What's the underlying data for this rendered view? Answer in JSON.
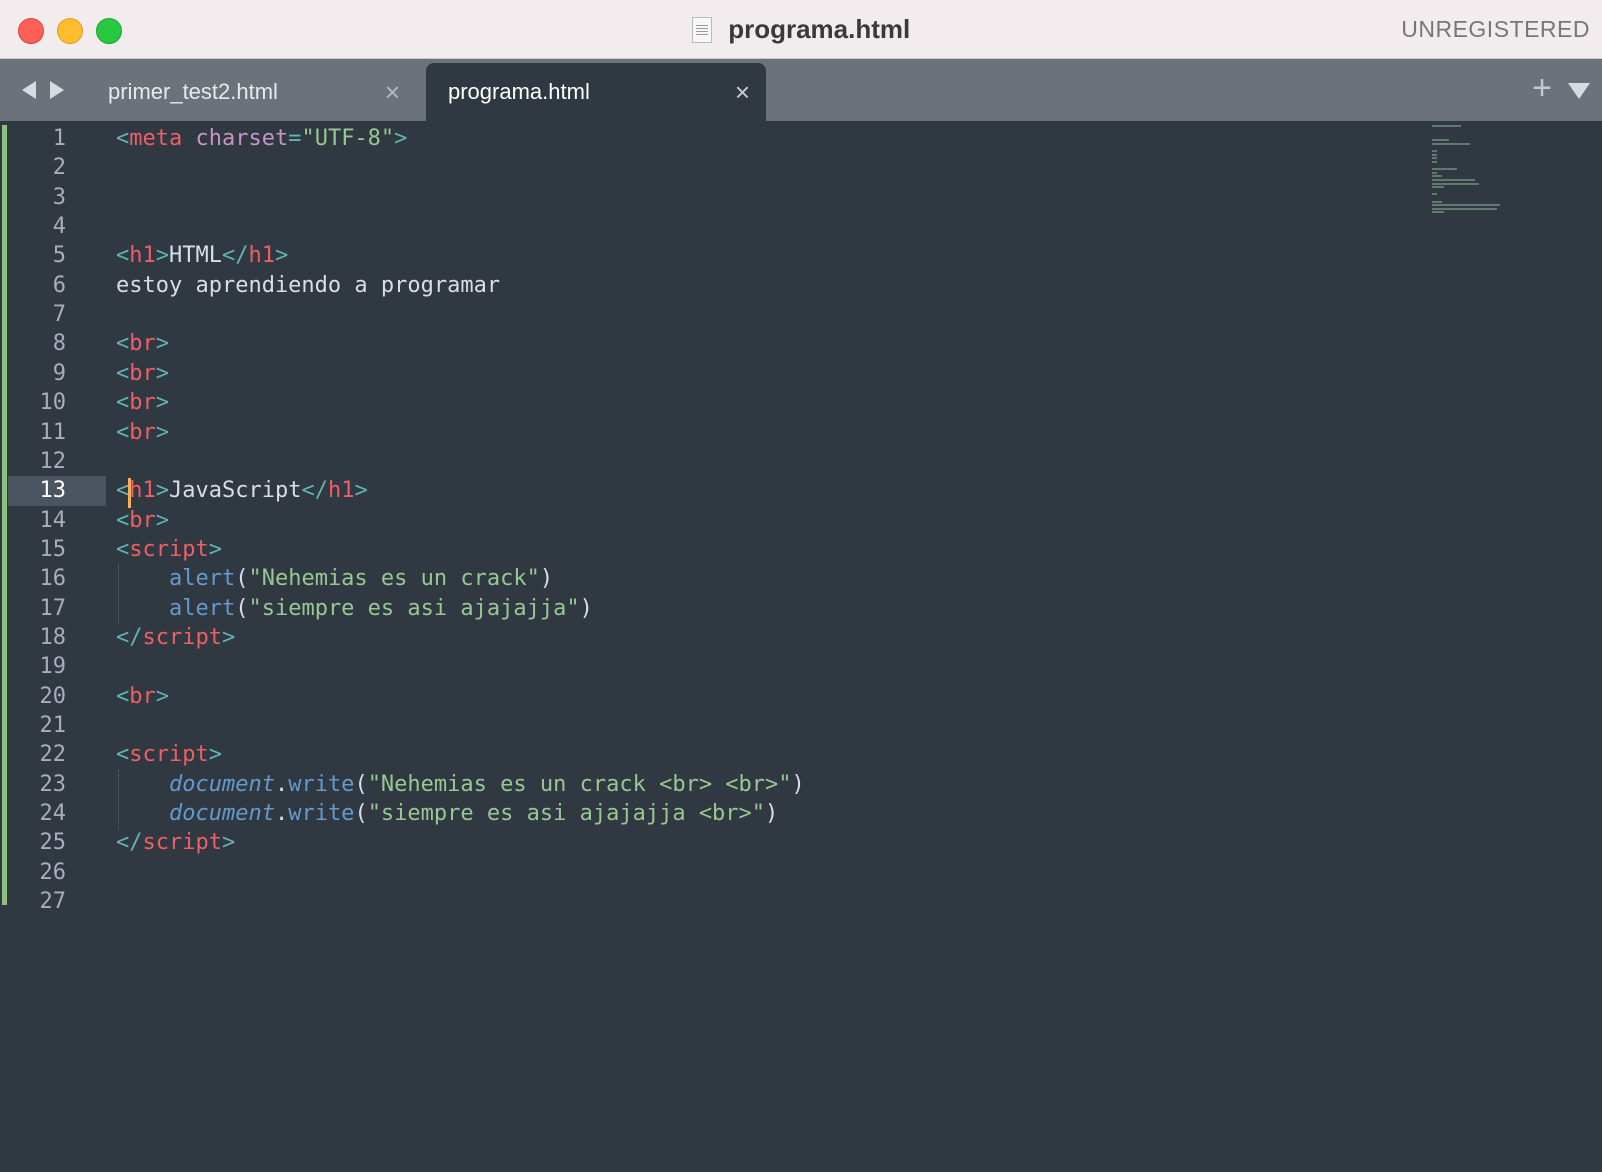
{
  "window": {
    "title": "programa.html",
    "status": "UNREGISTERED",
    "controls": [
      "close",
      "minimize",
      "maximize"
    ]
  },
  "tabs": [
    {
      "label": "primer_test2.html",
      "active": false,
      "close": "×"
    },
    {
      "label": "programa.html",
      "active": true,
      "close": "×"
    }
  ],
  "tabbar": {
    "add_label": "+",
    "back_icon": "chevron-left-icon",
    "forward_icon": "chevron-right-icon",
    "menu_icon": "triangle-down-icon"
  },
  "editor": {
    "current_line": 13,
    "line_numbers": [
      "1",
      "2",
      "3",
      "4",
      "5",
      "6",
      "7",
      "8",
      "9",
      "10",
      "11",
      "12",
      "13",
      "14",
      "15",
      "16",
      "17",
      "18",
      "19",
      "20",
      "21",
      "22",
      "23",
      "24",
      "25",
      "26",
      "27"
    ],
    "lines": [
      [
        [
          "p",
          "<"
        ],
        [
          "t",
          "meta"
        ],
        [
          "n",
          " "
        ],
        [
          "a",
          "charset"
        ],
        [
          "p",
          "="
        ],
        [
          "s",
          "\"UTF-8\""
        ],
        [
          "p",
          ">"
        ]
      ],
      [],
      [],
      [],
      [
        [
          "p",
          "<"
        ],
        [
          "t",
          "h1"
        ],
        [
          "p",
          ">"
        ],
        [
          "n",
          "HTML"
        ],
        [
          "p",
          "</"
        ],
        [
          "t",
          "h1"
        ],
        [
          "p",
          ">"
        ]
      ],
      [
        [
          "n",
          "estoy aprendiendo a programar"
        ]
      ],
      [],
      [
        [
          "p",
          "<"
        ],
        [
          "t",
          "br"
        ],
        [
          "p",
          ">"
        ]
      ],
      [
        [
          "p",
          "<"
        ],
        [
          "t",
          "br"
        ],
        [
          "p",
          ">"
        ]
      ],
      [
        [
          "p",
          "<"
        ],
        [
          "t",
          "br"
        ],
        [
          "p",
          ">"
        ]
      ],
      [
        [
          "p",
          "<"
        ],
        [
          "t",
          "br"
        ],
        [
          "p",
          ">"
        ]
      ],
      [],
      [
        [
          "p",
          "<"
        ],
        [
          "t",
          "h1"
        ],
        [
          "p",
          ">"
        ],
        [
          "n",
          "JavaScript"
        ],
        [
          "p",
          "</"
        ],
        [
          "t",
          "h1"
        ],
        [
          "p",
          ">"
        ]
      ],
      [
        [
          "p",
          "<"
        ],
        [
          "t",
          "br"
        ],
        [
          "p",
          ">"
        ]
      ],
      [
        [
          "p",
          "<"
        ],
        [
          "t",
          "script"
        ],
        [
          "p",
          ">"
        ]
      ],
      [
        [
          "n",
          "    "
        ],
        [
          "f",
          "alert"
        ],
        [
          "n",
          "("
        ],
        [
          "s",
          "\"Nehemias es un crack\""
        ],
        [
          "n",
          ")"
        ]
      ],
      [
        [
          "n",
          "    "
        ],
        [
          "f",
          "alert"
        ],
        [
          "n",
          "("
        ],
        [
          "s",
          "\"siempre es asi ajajajja\""
        ],
        [
          "n",
          ")"
        ]
      ],
      [
        [
          "p",
          "</"
        ],
        [
          "t",
          "script"
        ],
        [
          "p",
          ">"
        ]
      ],
      [],
      [
        [
          "p",
          "<"
        ],
        [
          "t",
          "br"
        ],
        [
          "p",
          ">"
        ]
      ],
      [],
      [
        [
          "p",
          "<"
        ],
        [
          "t",
          "script"
        ],
        [
          "p",
          ">"
        ]
      ],
      [
        [
          "n",
          "    "
        ],
        [
          "o",
          "document"
        ],
        [
          "n",
          "."
        ],
        [
          "f",
          "write"
        ],
        [
          "n",
          "("
        ],
        [
          "s",
          "\"Nehemias es un crack <br> <br>\""
        ],
        [
          "n",
          ")"
        ]
      ],
      [
        [
          "n",
          "    "
        ],
        [
          "o",
          "document"
        ],
        [
          "n",
          "."
        ],
        [
          "f",
          "write"
        ],
        [
          "n",
          "("
        ],
        [
          "s",
          "\"siempre es asi ajajajja <br>\""
        ],
        [
          "n",
          ")"
        ]
      ],
      [
        [
          "p",
          "</"
        ],
        [
          "t",
          "script"
        ],
        [
          "p",
          ">"
        ]
      ],
      [],
      []
    ]
  },
  "colors": {
    "background": "#303841",
    "tag": "#ec5f66",
    "punctuation": "#5fb4b4",
    "attribute": "#c695c6",
    "string": "#99c794",
    "function": "#6699cc",
    "text": "#d8dee9",
    "caret": "#f9ae58",
    "gutter_modified": "#8fbf7f"
  }
}
